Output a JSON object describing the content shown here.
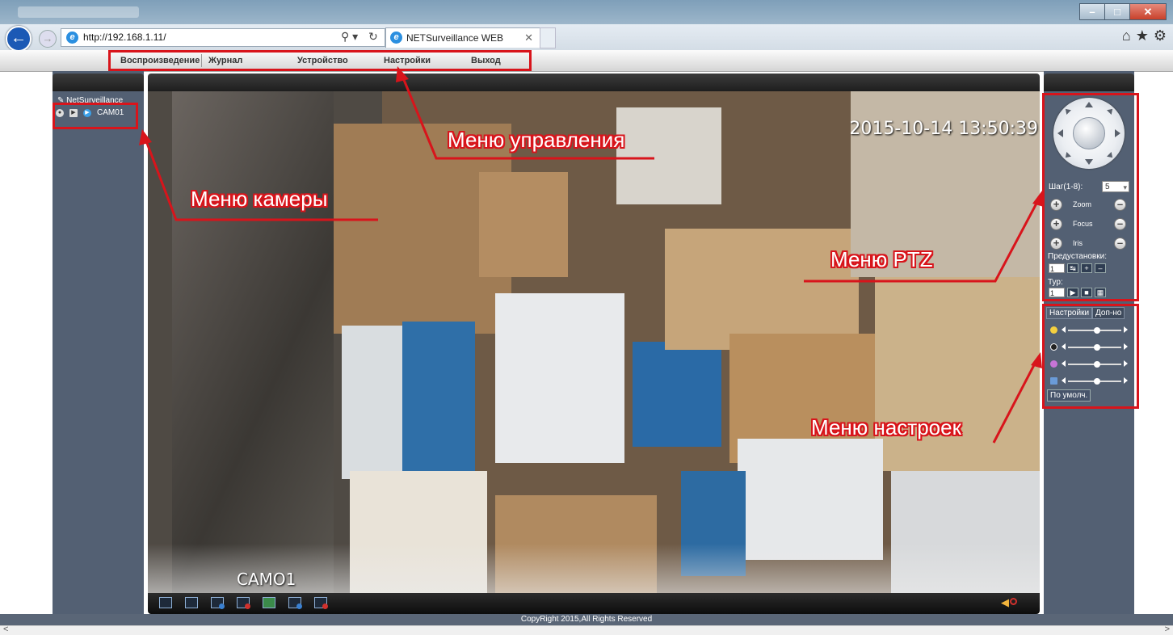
{
  "browser": {
    "url": "http://192.168.1.11/",
    "tab_title": "NETSurveillance WEB",
    "tab_close": "✕",
    "back_glyph": "←",
    "forward_glyph": "→",
    "search_glyph": "⚲ ▾",
    "refresh_glyph": "↻",
    "ie_letter": "e",
    "home_glyph": "⌂",
    "favorites_glyph": "★",
    "tools_glyph": "⚙",
    "minimize": "–",
    "maximize": "□",
    "close": "✕"
  },
  "topnav": {
    "items": [
      "Воспроизведение",
      "Журнал",
      "Устройство",
      "Настройки",
      "Выход"
    ]
  },
  "left_panel": {
    "root_label": "NetSurveillance",
    "camera_label": "CAM01"
  },
  "video": {
    "timestamp": "2015-10-14 13:50:39",
    "channel_label": "CAMO1"
  },
  "ptz": {
    "step_label": "Шаг(1-8):",
    "step_value": "5",
    "zoom_label": "Zoom",
    "focus_label": "Focus",
    "iris_label": "Iris",
    "presets_label": "Предустановки:",
    "preset_value": "1",
    "tour_label": "Тур:",
    "tour_value": "1"
  },
  "settings": {
    "tab_settings": "Настройки",
    "tab_extra": "Доп-но",
    "sliders": [
      {
        "name": "brightness",
        "level": 0.55,
        "color": "#f4d03f"
      },
      {
        "name": "contrast",
        "level": 0.55,
        "color": "#222222"
      },
      {
        "name": "saturation",
        "level": 0.55,
        "color": "#c774d6"
      },
      {
        "name": "hue",
        "level": 0.55,
        "color": "#6a9bd8"
      }
    ],
    "default_button": "По умолч."
  },
  "footer": {
    "copyright": "CopyRight 2015,All Rights Reserved"
  },
  "annotations": {
    "control_menu": "Меню управления",
    "camera_menu": "Меню камеры",
    "ptz_menu": "Меню PTZ",
    "settings_menu": "Меню настроек"
  },
  "colors": {
    "annotation_red": "#d8141b",
    "panel_bg": "#536073"
  }
}
